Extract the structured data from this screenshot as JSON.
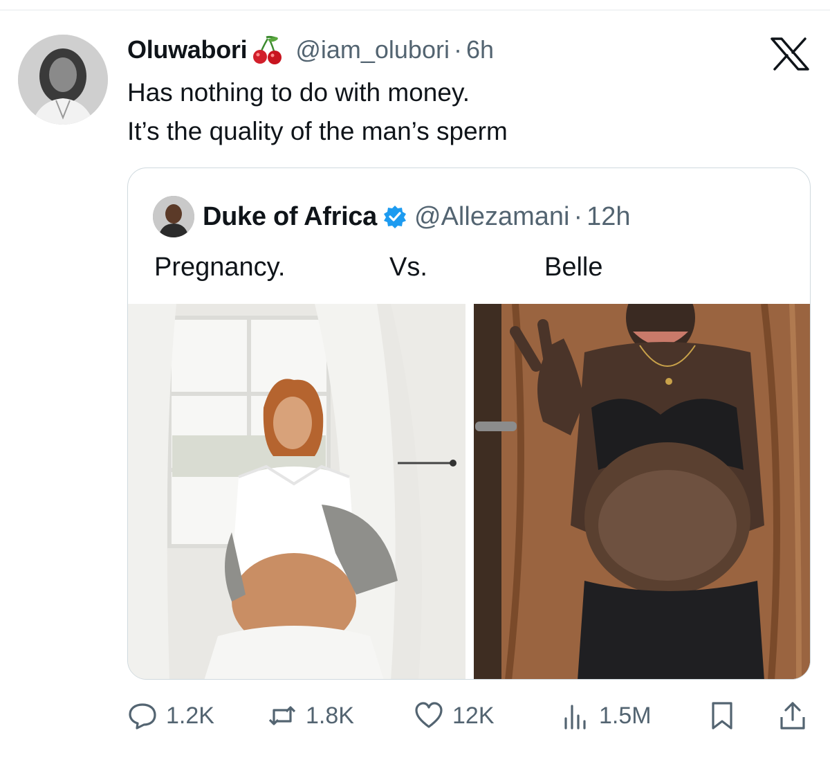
{
  "tweet": {
    "name": "Oluwabori",
    "handle": "@iam_olubori",
    "separator": "·",
    "time": "6h",
    "lines": [
      "Has nothing to do with money.",
      "It’s the quality of the man’s sperm"
    ]
  },
  "quoted": {
    "name": "Duke of Africa",
    "handle": "@Allezamani",
    "separator": "·",
    "time": "12h",
    "caption": [
      "Pregnancy.",
      "Vs.",
      "Belle"
    ]
  },
  "actions": {
    "replies": "1.2K",
    "reposts": "1.8K",
    "likes": "12K",
    "views": "1.5M"
  },
  "icons": {
    "name_emoji": "cherries-icon",
    "platform": "x-logo-icon",
    "verified": "verified-badge-icon"
  },
  "colors": {
    "text": "#0f1419",
    "muted": "#536471",
    "verified_blue": "#1d9bf0",
    "border": "#cfd9de"
  }
}
